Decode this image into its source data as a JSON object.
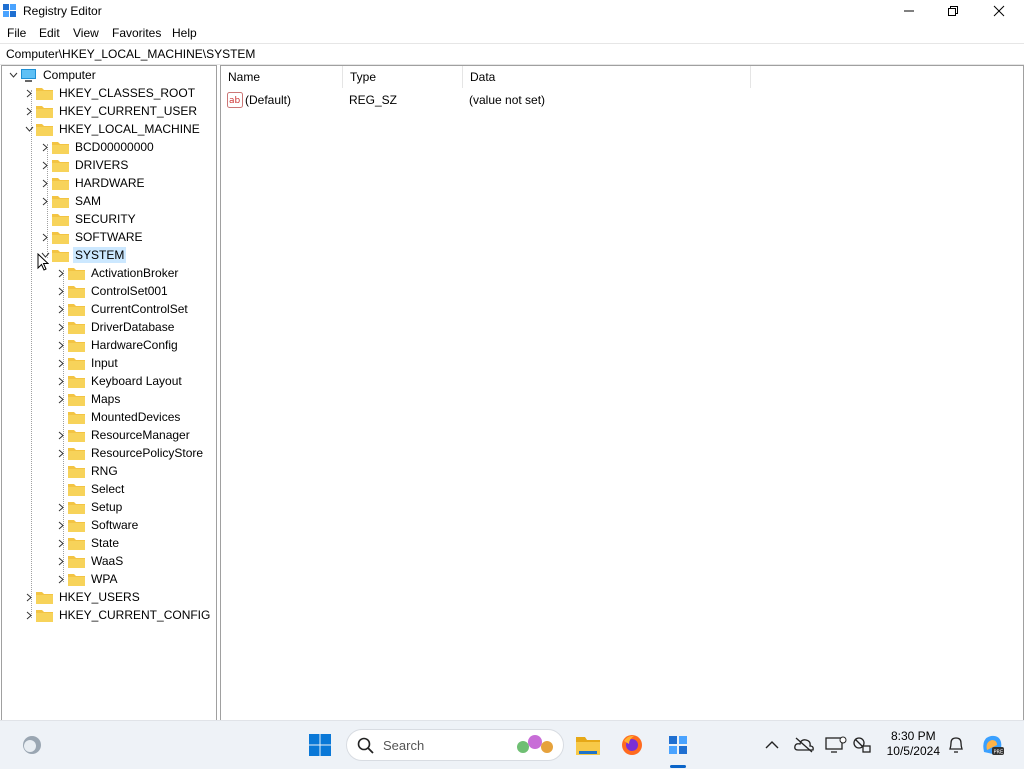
{
  "window": {
    "title": "Registry Editor",
    "controls": [
      "minimize",
      "maximize",
      "close"
    ]
  },
  "menu": [
    "File",
    "Edit",
    "View",
    "Favorites",
    "Help"
  ],
  "address": "Computer\\HKEY_LOCAL_MACHINE\\SYSTEM",
  "tree": {
    "root": "Computer",
    "hives": [
      "HKEY_CLASSES_ROOT",
      "HKEY_CURRENT_USER",
      "HKEY_LOCAL_MACHINE",
      "HKEY_USERS",
      "HKEY_CURRENT_CONFIG"
    ],
    "hklm_children": [
      "BCD00000000",
      "DRIVERS",
      "HARDWARE",
      "SAM",
      "SECURITY",
      "SOFTWARE",
      "SYSTEM"
    ],
    "system_children": [
      "ActivationBroker",
      "ControlSet001",
      "CurrentControlSet",
      "DriverDatabase",
      "HardwareConfig",
      "Input",
      "Keyboard Layout",
      "Maps",
      "MountedDevices",
      "ResourceManager",
      "ResourcePolicyStore",
      "RNG",
      "Select",
      "Setup",
      "Software",
      "State",
      "WaaS",
      "WPA"
    ]
  },
  "list": {
    "columns": [
      "Name",
      "Type",
      "Data"
    ],
    "rows": [
      {
        "name": "(Default)",
        "type": "REG_SZ",
        "data": "(value not set)"
      }
    ]
  },
  "taskbar": {
    "search_placeholder": "Search",
    "time": "8:30 PM",
    "date": "10/5/2024"
  },
  "colors": {
    "selection": "#cce8ff",
    "folder": "#f3c443",
    "accent": "#0a64c8"
  }
}
